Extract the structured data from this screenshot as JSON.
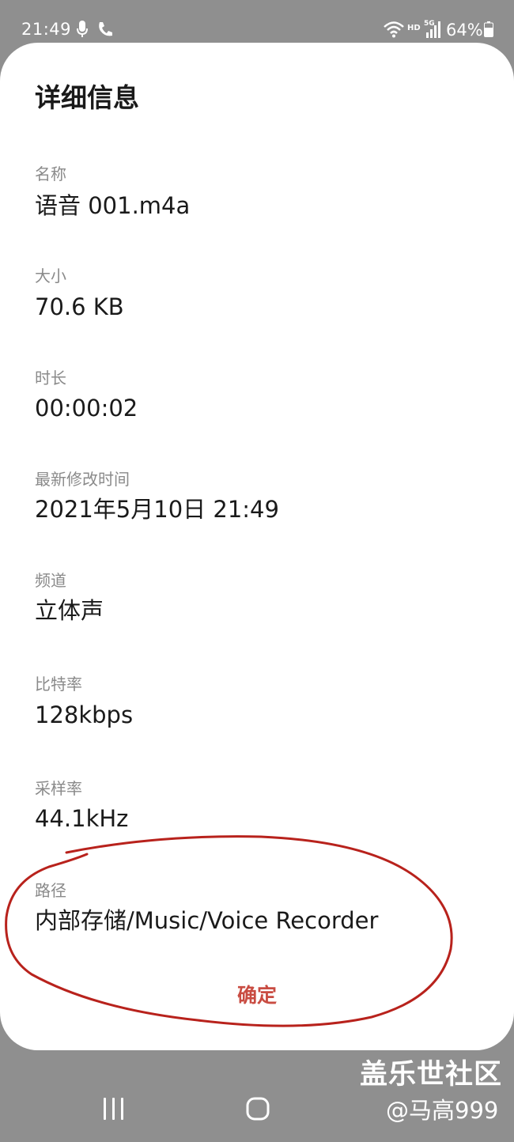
{
  "status_bar": {
    "time": "21:49",
    "hd_label": "HD",
    "network_label": "5G",
    "battery_percent": "64%",
    "icons": [
      "microphone-icon",
      "call-icon",
      "wifi-icon",
      "signal-icon",
      "battery-icon"
    ]
  },
  "dialog": {
    "title": "详细信息",
    "fields": [
      {
        "label": "名称",
        "value": "语音 001.m4a"
      },
      {
        "label": "大小",
        "value": "70.6 KB"
      },
      {
        "label": "时长",
        "value": "00:00:02"
      },
      {
        "label": "最新修改时间",
        "value": "2021年5月10日 21:49"
      },
      {
        "label": "频道",
        "value": "立体声"
      },
      {
        "label": "比特率",
        "value": "128kbps"
      },
      {
        "label": "采样率",
        "value": "44.1kHz"
      },
      {
        "label": "路径",
        "value": "内部存储/Music/Voice Recorder"
      }
    ],
    "ok_label": "确定",
    "accent_color": "#c94c42",
    "annotation_color": "#b8221c"
  },
  "watermark": {
    "brand": "盖乐世社区",
    "user": "@马高999"
  },
  "nav_bar": {
    "icons": [
      "recent-apps-icon",
      "home-icon"
    ]
  }
}
